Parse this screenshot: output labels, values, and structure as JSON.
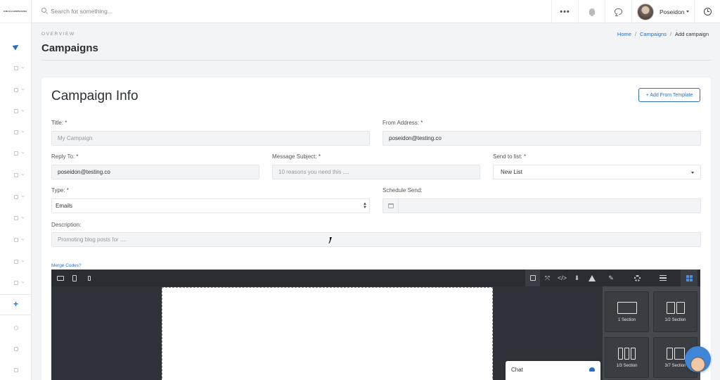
{
  "app": {
    "logo_text": "EMAILCHIMPANZEE"
  },
  "topbar": {
    "search_placeholder": "Search for something...",
    "more_label": "•••",
    "user_name": "Poseidon"
  },
  "sidebar": {
    "items": [
      "send-icon",
      "box-icon",
      "box-icon",
      "list-icon",
      "folder-icon",
      "check-icon",
      "mail-icon",
      "box-icon",
      "box-icon",
      "copy-icon",
      "box-icon",
      "file-icon",
      "plus-icon",
      "globe-icon",
      "megaphone-icon",
      "book-icon"
    ],
    "add_label": "+"
  },
  "header": {
    "overline": "OVERVIEW",
    "title": "Campaigns",
    "breadcrumb": {
      "home": "Home",
      "sep1": "/",
      "campaigns": "Campaigns",
      "sep2": "/",
      "current": "Add campaign"
    }
  },
  "form": {
    "card_title": "Campaign Info",
    "add_template_label": "+ Add From Template",
    "title_label": "Title: *",
    "title_placeholder": "My Campaign",
    "from_label": "From Address: *",
    "from_value": "poseidon@testing.co",
    "reply_label": "Reply To: *",
    "reply_value": "poseidon@testing.co",
    "subject_label": "Message Subject: *",
    "subject_placeholder": "10 reasons you need this ....",
    "list_label": "Send to list: *",
    "list_value": "New List",
    "type_label": "Type: *",
    "type_value": "Emails",
    "schedule_label": "Schedule Send:",
    "description_label": "Description:",
    "description_placeholder": "Promoting blog posts for ....",
    "merge_codes_label": "Merge Codes?"
  },
  "editor": {
    "device_icons": [
      "desktop-icon",
      "tablet-icon",
      "mobile-icon"
    ],
    "tool_icons": [
      "square-icon",
      "fullscreen-icon",
      "code-icon",
      "download-icon",
      "warning-icon",
      "brush-icon",
      "gear-icon",
      "menu-icon",
      "grid-icon"
    ],
    "blocks": [
      {
        "label": "1 Section"
      },
      {
        "label": "1/2 Section"
      },
      {
        "label": "1/3 Section"
      },
      {
        "label": "3/7 Section"
      }
    ]
  },
  "chat": {
    "label": "Chat"
  },
  "colors": {
    "accent": "#2a6ec2",
    "editor_bg": "#2f3238",
    "panel_bg": "#45484e"
  }
}
